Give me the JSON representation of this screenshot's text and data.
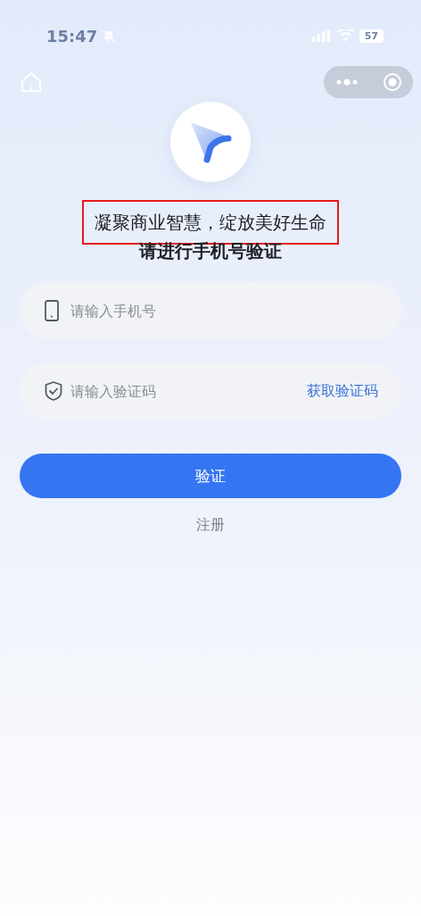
{
  "status_bar": {
    "time": "15:47",
    "silent": true,
    "battery": "57"
  },
  "slogan": {
    "text": "凝聚商业智慧，绽放美好生命",
    "highlighted": true
  },
  "subtitle": "请进行手机号验证",
  "fields": [
    {
      "kind": "phone",
      "placeholder": "请输入手机号"
    },
    {
      "kind": "code",
      "placeholder": "请输入验证码",
      "action": "获取验证码"
    }
  ],
  "submit_button": "验证",
  "register_link": "注册"
}
